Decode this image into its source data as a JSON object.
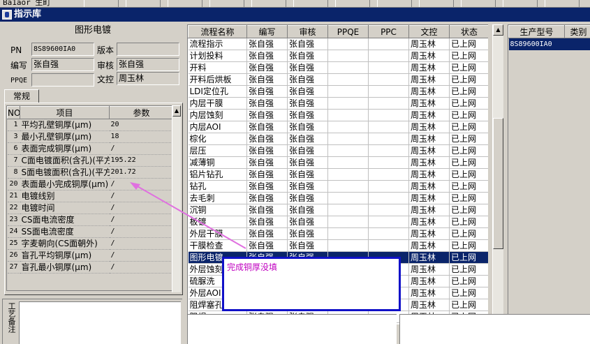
{
  "window": {
    "title": "指示库",
    "toolbar_text": "Ba1aor  生町"
  },
  "left_panel": {
    "title": "图形电镀",
    "fields": {
      "pn_label": "PN",
      "pn_value": "8S89600IA0",
      "version_label": "版本",
      "version_value": "",
      "author_label": "编写",
      "author_value": "张自强",
      "reviewer_label": "审核",
      "reviewer_value": "张自强",
      "ppqe_label": "PPQE",
      "ppqe_value": "",
      "docctrl_label": "文控",
      "docctrl_value": "周玉林"
    },
    "tab_label": "常规",
    "param_columns": [
      "NO",
      "项目",
      "参数"
    ],
    "params": [
      {
        "no": "1",
        "item": "平均孔壁铜厚(μm)",
        "value": "20"
      },
      {
        "no": "3",
        "item": "最小孔壁铜厚(μm)",
        "value": "18"
      },
      {
        "no": "6",
        "item": "表面完成铜厚(μm)",
        "value": "/"
      },
      {
        "no": "7",
        "item": "C面电镀面积(含孔)(平方",
        "value": "195.22"
      },
      {
        "no": "8",
        "item": "S面电镀面积(含孔)(平方",
        "value": "201.72"
      },
      {
        "no": "20",
        "item": "表面最小完成铜厚(μm)",
        "value": "/"
      },
      {
        "no": "21",
        "item": "电镀线别",
        "value": "/"
      },
      {
        "no": "22",
        "item": "电镀时间",
        "value": "/"
      },
      {
        "no": "23",
        "item": "CS面电流密度",
        "value": "/"
      },
      {
        "no": "24",
        "item": "SS面电流密度",
        "value": "/"
      },
      {
        "no": "25",
        "item": "字麦朝向(CS面朝外)",
        "value": "/"
      },
      {
        "no": "26",
        "item": "盲孔平均铜厚(μm)",
        "value": "/"
      },
      {
        "no": "27",
        "item": "盲孔最小铜厚(μm)",
        "value": "/"
      }
    ],
    "notes_label": "工艺备注"
  },
  "process_grid": {
    "columns": [
      "流程名称",
      "编写",
      "审核",
      "PPQE",
      "PPC",
      "文控",
      "状态"
    ],
    "rows": [
      [
        "流程指示",
        "张自强",
        "张自强",
        "",
        "",
        "周玉林",
        "已上网"
      ],
      [
        "计划投料",
        "张自强",
        "张自强",
        "",
        "",
        "周玉林",
        "已上网"
      ],
      [
        "开料",
        "张自强",
        "张自强",
        "",
        "",
        "周玉林",
        "已上网"
      ],
      [
        "开料后烘板",
        "张自强",
        "张自强",
        "",
        "",
        "周玉林",
        "已上网"
      ],
      [
        "LDI定位孔",
        "张自强",
        "张自强",
        "",
        "",
        "周玉林",
        "已上网"
      ],
      [
        "内层干膜",
        "张自强",
        "张自强",
        "",
        "",
        "周玉林",
        "已上网"
      ],
      [
        "内层蚀刻",
        "张自强",
        "张自强",
        "",
        "",
        "周玉林",
        "已上网"
      ],
      [
        "内层AOI",
        "张自强",
        "张自强",
        "",
        "",
        "周玉林",
        "已上网"
      ],
      [
        "棕化",
        "张自强",
        "张自强",
        "",
        "",
        "周玉林",
        "已上网"
      ],
      [
        "层压",
        "张自强",
        "张自强",
        "",
        "",
        "周玉林",
        "已上网"
      ],
      [
        "减薄铜",
        "张自强",
        "张自强",
        "",
        "",
        "周玉林",
        "已上网"
      ],
      [
        "铝片钻孔",
        "张自强",
        "张自强",
        "",
        "",
        "周玉林",
        "已上网"
      ],
      [
        "钻孔",
        "张自强",
        "张自强",
        "",
        "",
        "周玉林",
        "已上网"
      ],
      [
        "去毛刺",
        "张自强",
        "张自强",
        "",
        "",
        "周玉林",
        "已上网"
      ],
      [
        "沉铜",
        "张自强",
        "张自强",
        "",
        "",
        "周玉林",
        "已上网"
      ],
      [
        "板镀",
        "张自强",
        "张自强",
        "",
        "",
        "周玉林",
        "已上网"
      ],
      [
        "外层干膜",
        "张自强",
        "张自强",
        "",
        "",
        "周玉林",
        "已上网"
      ],
      [
        "干膜检查",
        "张自强",
        "张自强",
        "",
        "",
        "周玉林",
        "已上网"
      ],
      [
        "图形电镀",
        "张自强",
        "张自强",
        "",
        "",
        "周玉林",
        "已上网"
      ],
      [
        "外层蚀刻",
        "张自强",
        "张自强",
        "",
        "",
        "周玉林",
        "已上网"
      ],
      [
        "硫脲洗",
        "张自强",
        "张自强",
        "",
        "",
        "周玉林",
        "已上网"
      ],
      [
        "外层AOI",
        "张自强",
        "张自强",
        "",
        "",
        "周玉林",
        "已上网"
      ],
      [
        "阻焊塞孔",
        "张自强",
        "张自强",
        "",
        "",
        "周玉林",
        "已上网"
      ],
      [
        "阻焊",
        "张自强",
        "张自强",
        "",
        "",
        "周玉林",
        "已上网"
      ]
    ],
    "selected_index": 18
  },
  "product_grid": {
    "columns": [
      "生产型号",
      "类别"
    ],
    "rows": [
      [
        "8S89600IA0",
        ""
      ]
    ]
  },
  "annotation": {
    "text": "完成铜厚没填",
    "color": "#c000c0"
  }
}
